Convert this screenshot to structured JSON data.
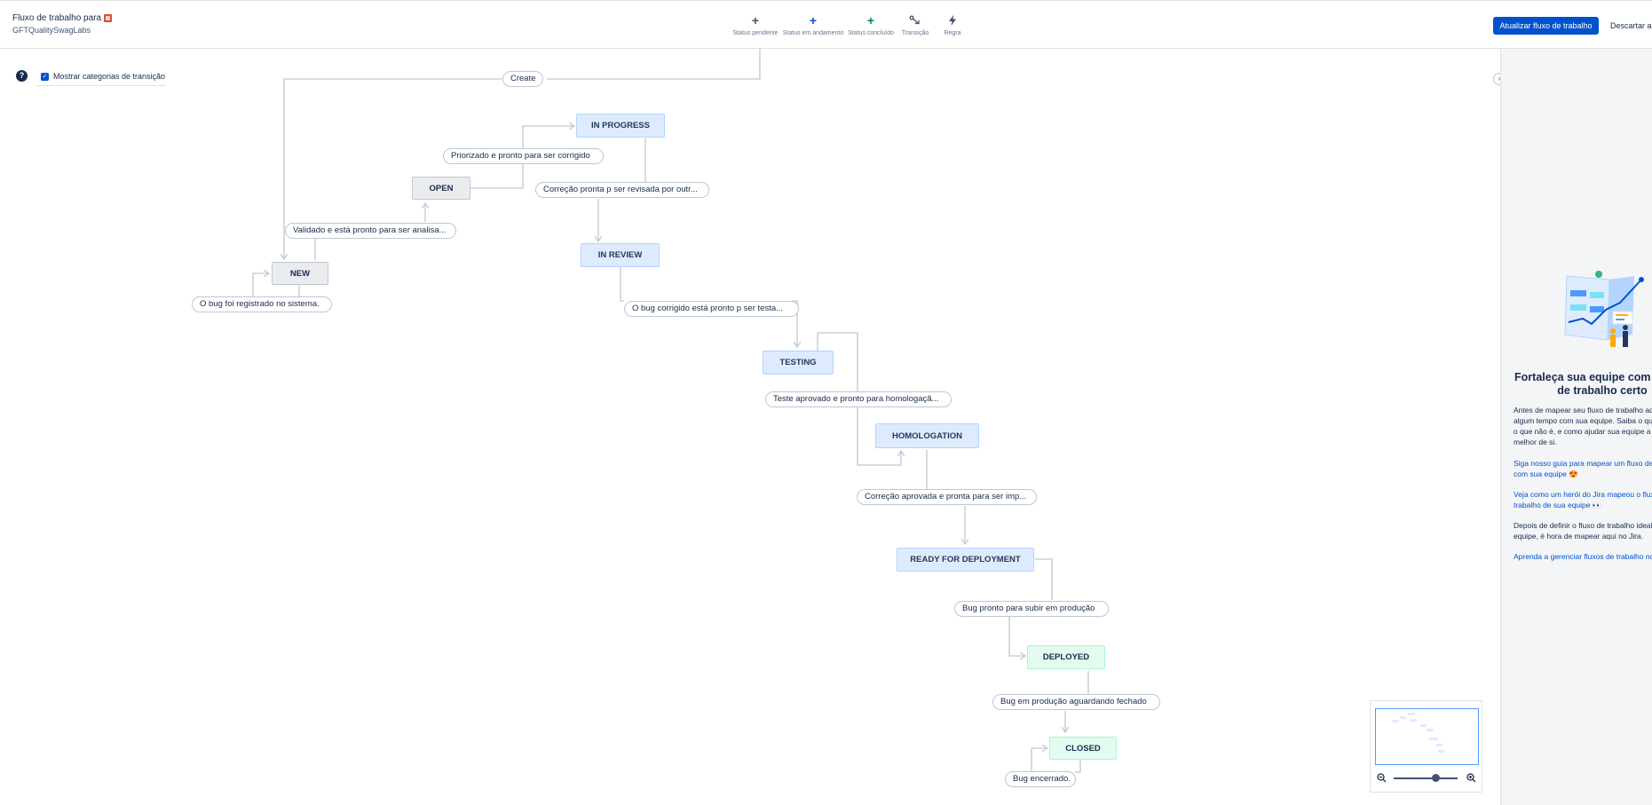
{
  "header": {
    "title": "Fluxo de trabalho para",
    "project": "GFTQualitySwagLabs",
    "tools": [
      {
        "icon": "plus-icon",
        "label": "Status pendente",
        "color": "#42526e"
      },
      {
        "icon": "plus-icon",
        "label": "Status em andamento",
        "color": "#0052cc"
      },
      {
        "icon": "plus-icon",
        "label": "Status concluído",
        "color": "#00875a"
      },
      {
        "icon": "transition-icon",
        "label": "Transição",
        "color": "#42526e"
      },
      {
        "icon": "bolt-icon",
        "label": "Regra",
        "color": "#42526e"
      }
    ],
    "update_button": "Atualizar fluxo de trabalho",
    "discard_button": "Descartar al"
  },
  "canvas": {
    "toggle_label": "Mostrar categorias de transição",
    "toggle_checked": true,
    "statuses": {
      "new": "NEW",
      "open": "OPEN",
      "in_progress": "IN PROGRESS",
      "in_review": "IN REVIEW",
      "testing": "TESTING",
      "homologation": "HOMOLOGATION",
      "ready": "READY FOR DEPLOYMENT",
      "deployed": "DEPLOYED",
      "closed": "CLOSED"
    },
    "transitions": {
      "create": "Create",
      "t_priorizado": "Priorizado e pronto para ser corrigido",
      "t_correcao": "Correção pronta p ser revisada por outr...",
      "t_validado": "Validado e está pronto para ser analisa...",
      "t_registrado": "O bug foi registrado no sistema.",
      "t_corrigido": "O bug corrigido está pronto p ser testa...",
      "t_teste": "Teste aprovado e pronto para homologaçã...",
      "t_correcao_aprovada": "Correção aprovada e pronta para ser imp...",
      "t_bug_pronto": "Bug pronto para subir em produção",
      "t_producao": "Bug em produção aguardando fechado",
      "t_encerrado": "Bug encerrado."
    },
    "colors": {
      "todo": "#ebecf0",
      "in_progress": "#deebff",
      "done": "#e3fcef",
      "accent": "#0052cc"
    }
  },
  "sidepanel": {
    "title": "Fortaleça sua equipe com o fluxo de trabalho certo",
    "intro": "Antes de mapear seu fluxo de trabalho aqui, passe algum tempo com sua equipe. Saiba o que é eficaz, o que não é, e como ajudar sua equipe a dar o melhor de si.",
    "link1": "Siga nosso guia para mapear um fluxo de trabalho com sua equipe 😍",
    "link2": "Veja como um herói do Jira mapeou o fluxo de trabalho de sua equipe 👀",
    "text2": "Depois de definir o fluxo de trabalho ideal para sua equipe, é hora de mapear aqui no Jira.",
    "link3": "Aprenda a gerenciar fluxos de trabalho no Jira 💡"
  },
  "zoom": {
    "level": 0.85
  }
}
